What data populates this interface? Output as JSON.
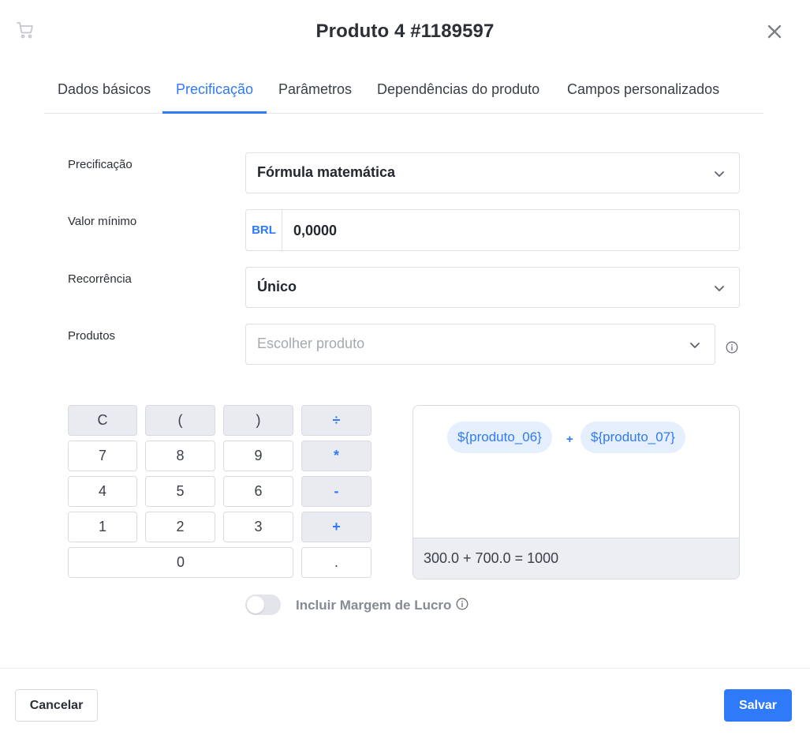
{
  "header": {
    "title": "Produto 4 #1189597",
    "cart_icon": "cart-icon",
    "close_icon": "close-icon"
  },
  "tabs": [
    {
      "label": "Dados básicos",
      "active": false
    },
    {
      "label": "Precificação",
      "active": true
    },
    {
      "label": "Parâmetros",
      "active": false
    },
    {
      "label": "Dependências do produto",
      "active": false
    },
    {
      "label": "Campos personalizados",
      "active": false
    }
  ],
  "form": {
    "pricing": {
      "label": "Precificação",
      "value": "Fórmula matemática"
    },
    "min_value": {
      "label": "Valor mínimo",
      "currency": "BRL",
      "value": "0,0000"
    },
    "recurrence": {
      "label": "Recorrência",
      "value": "Único"
    },
    "products": {
      "label": "Produtos",
      "placeholder": "Escolher produto"
    }
  },
  "calculator": {
    "keys": {
      "clear": "C",
      "lparen": "(",
      "rparen": ")",
      "divide": "÷",
      "k7": "7",
      "k8": "8",
      "k9": "9",
      "multiply": "*",
      "k4": "4",
      "k5": "5",
      "k6": "6",
      "minus": "-",
      "k1": "1",
      "k2": "2",
      "k3": "3",
      "plus": "+",
      "k0": "0",
      "dot": "."
    }
  },
  "formula": {
    "tokens": [
      "${produto_06}",
      "${produto_07}"
    ],
    "operator": "+",
    "result": "300.0 + 700.0 = 1000"
  },
  "profit_margin": {
    "label": "Incluir Margem de Lucro",
    "enabled": false
  },
  "footer": {
    "cancel_label": "Cancelar",
    "save_label": "Salvar"
  },
  "colors": {
    "accent": "#2f7af8",
    "chip_bg": "#e5effe",
    "muted": "#868a92"
  }
}
